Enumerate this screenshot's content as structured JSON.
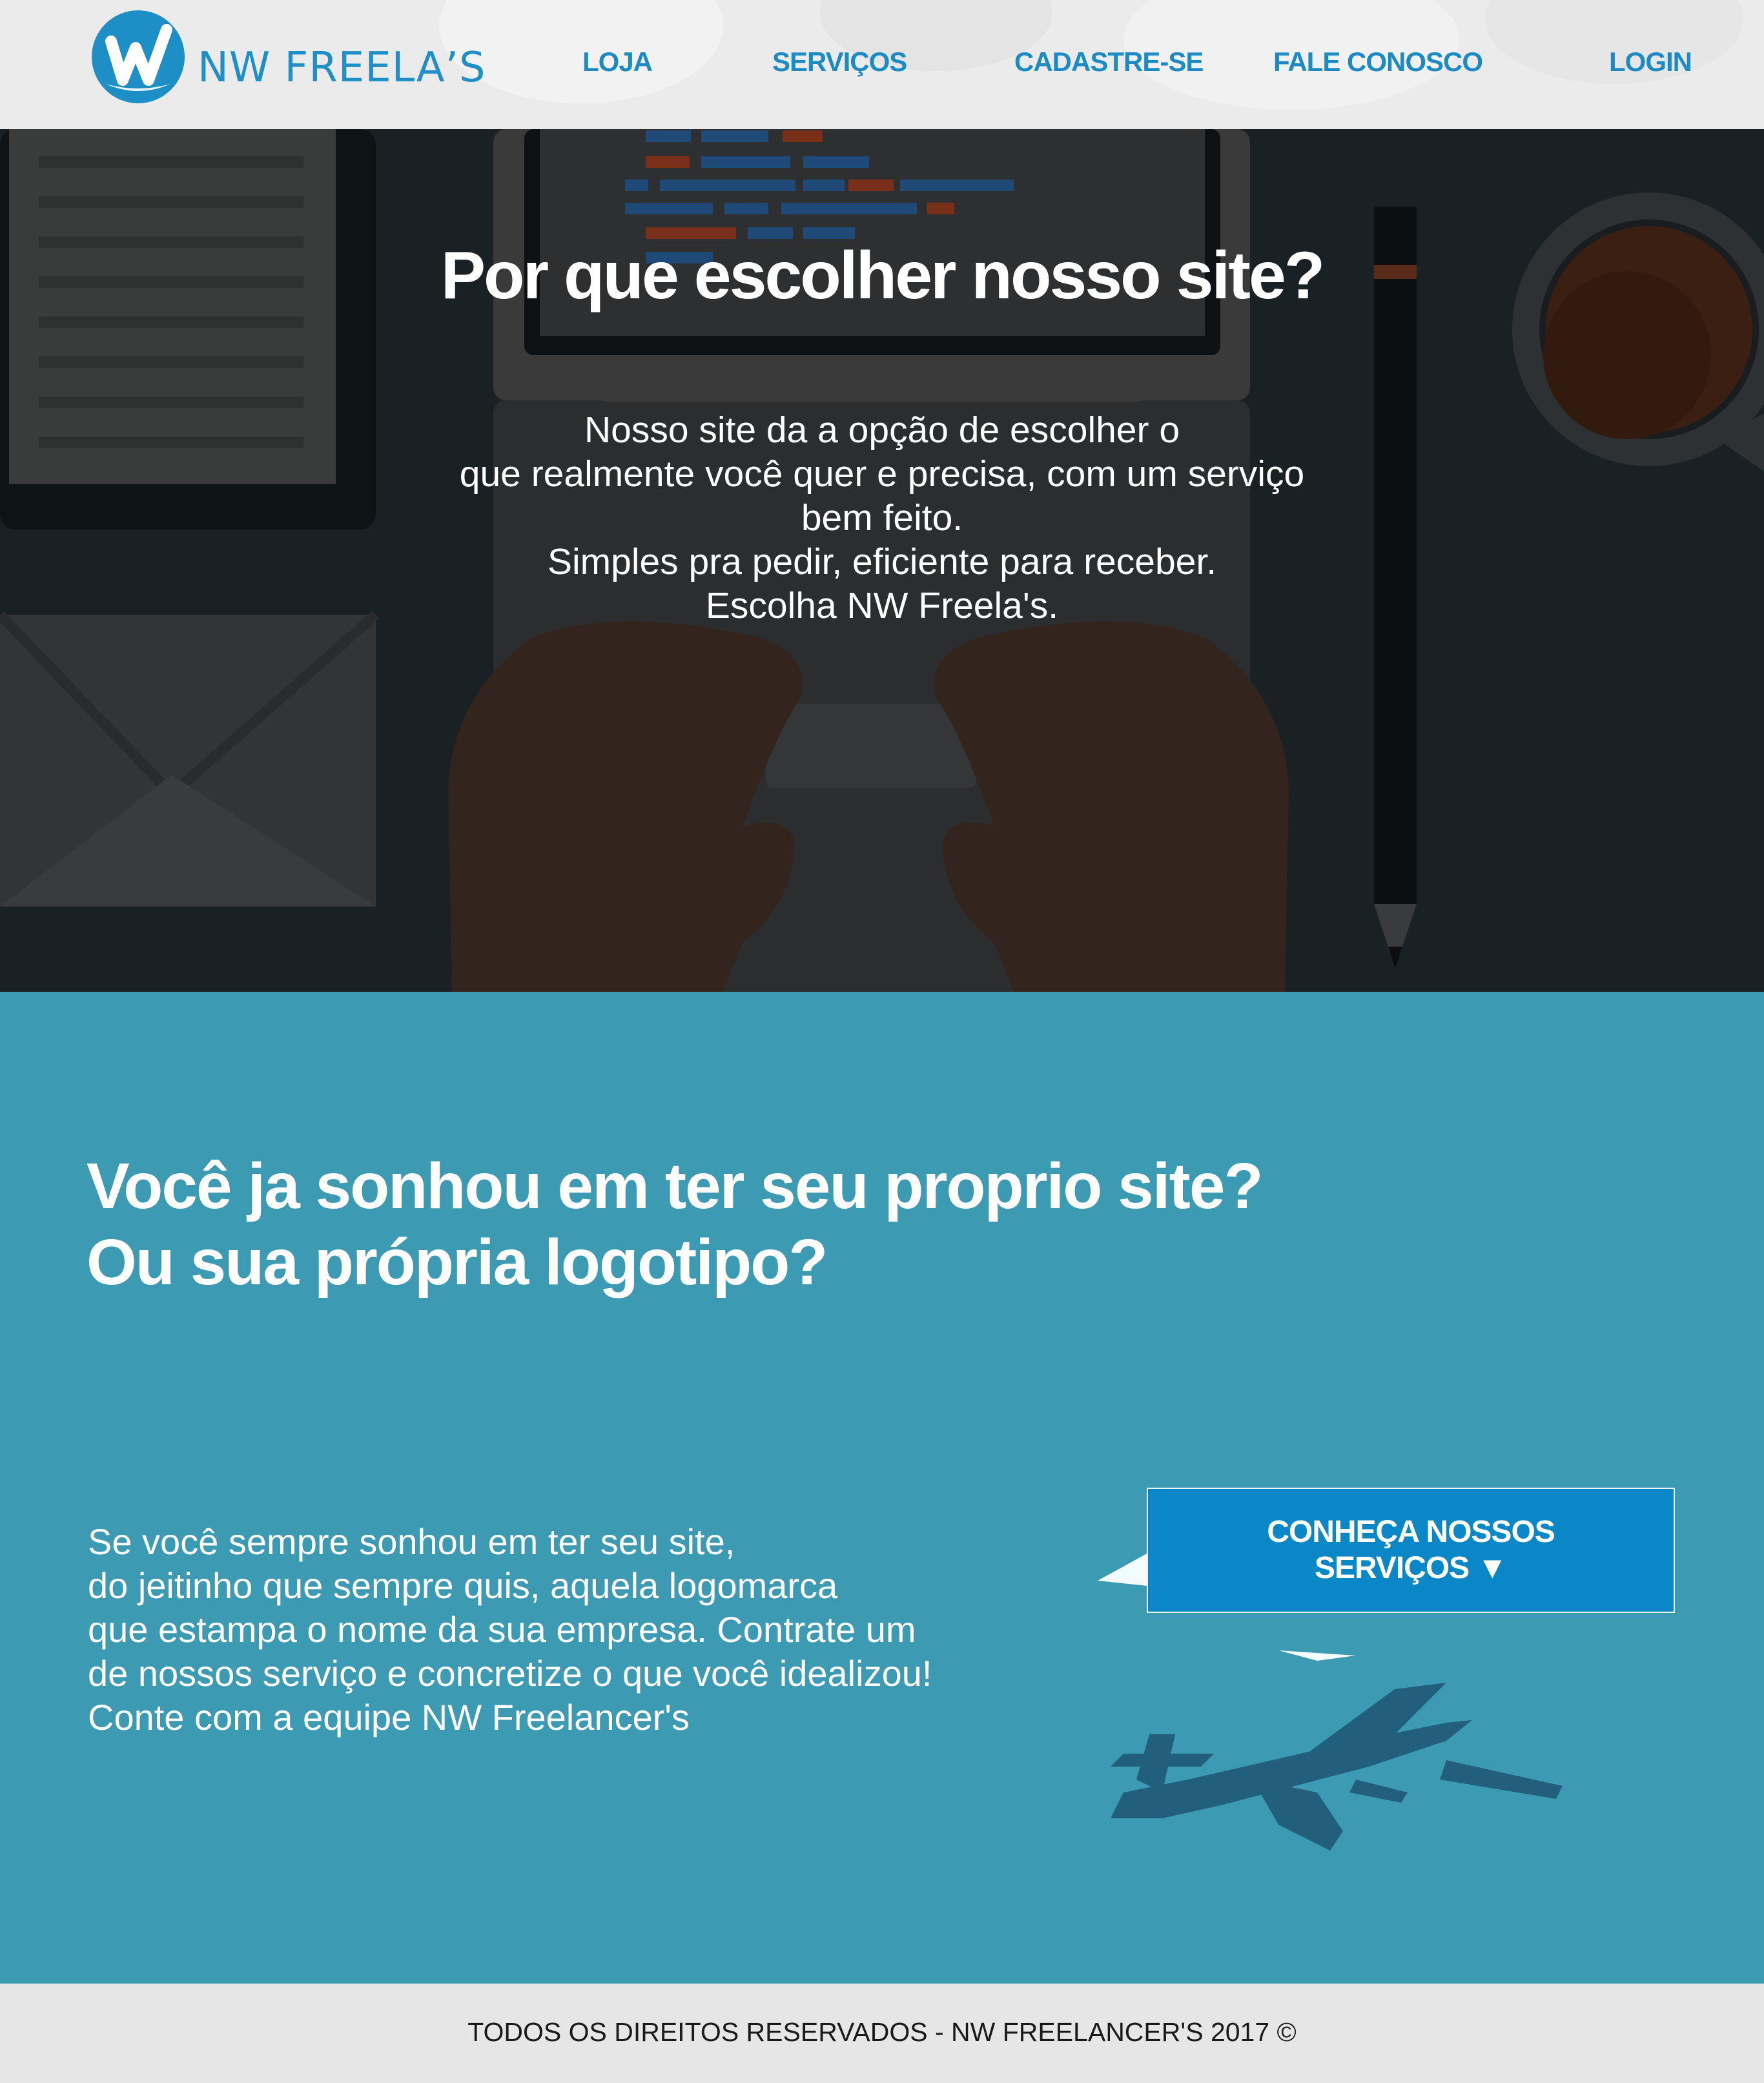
{
  "header": {
    "logo_text": "NW FREELA’S",
    "logo_icon": "nw-logo-icon",
    "nav": {
      "loja": "LOJA",
      "servicos": "SERVIÇOS",
      "cadastre": "CADASTRE-SE",
      "fale": "FALE CONOSCO",
      "login": "LOGIN"
    }
  },
  "hero": {
    "title": "Por que escolher nosso site?",
    "lines": [
      "Nosso site da a opção de escolher o",
      "que realmente você quer e precisa, com um serviço",
      "bem feito.",
      "Simples pra pedir, eficiente para receber.",
      "Escolha NW Freela's."
    ]
  },
  "dream": {
    "title_lines": [
      "Você ja sonhou em ter seu proprio site?",
      "Ou sua própria logotipo?"
    ],
    "text_lines": [
      "Se você sempre sonhou em ter seu site,",
      "do jeitinho que sempre quis, aquela logomarca",
      "que estampa o nome da sua empresa. Contrate um",
      "de nossos serviço e concretize o que você idealizou!",
      "Conte com a equipe NW Freelancer's"
    ],
    "cta_line1": "CONHEÇA NOSSOS",
    "cta_line2": "SERVIÇOS ▼"
  },
  "footer": {
    "text": "TODOS OS DIREITOS RESERVADOS - NW FREELANCER'S 2017 ©"
  },
  "colors": {
    "brand_blue": "#1c8ac3",
    "section_teal": "#3c9ab3",
    "hero_dark": "#1a2125",
    "cta_blue": "#0a87c6",
    "footer_gray": "#e6e6e6"
  }
}
